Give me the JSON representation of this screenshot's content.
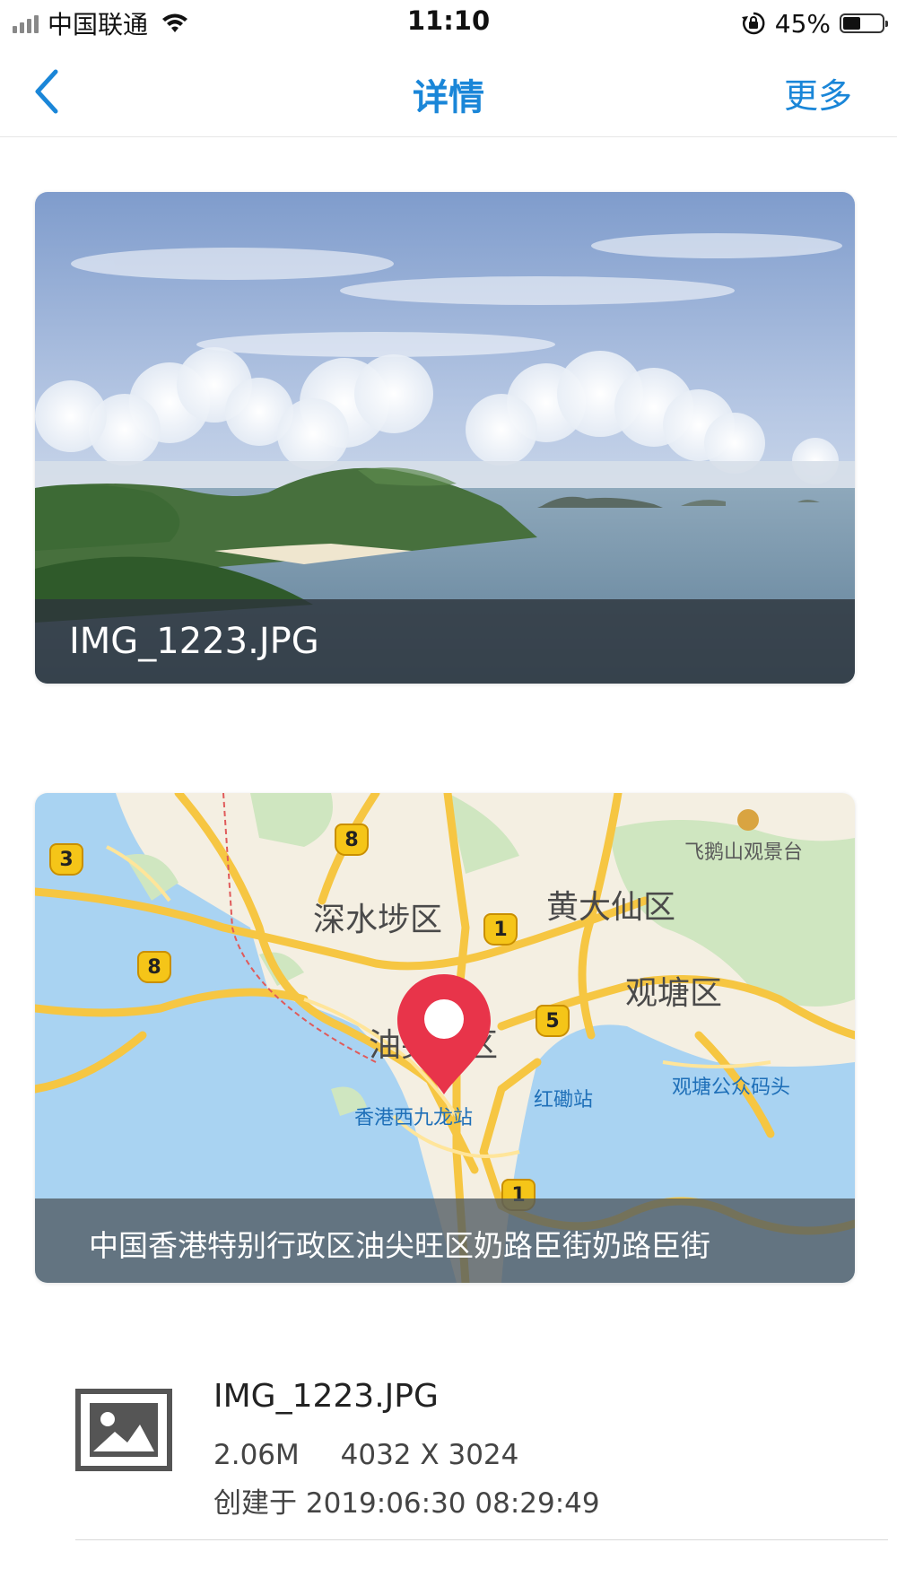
{
  "status_bar": {
    "carrier": "中国联通",
    "time": "11:10",
    "battery": "45%",
    "battery_level": 0.45,
    "icons": [
      "signal-icon",
      "wifi-icon",
      "rotation-lock-icon",
      "battery-icon"
    ]
  },
  "nav": {
    "title": "详情",
    "more": "更多",
    "back_icon": "chevron-left-icon",
    "accent_color": "#1a86d8"
  },
  "photo": {
    "filename": "IMG_1223.JPG"
  },
  "map": {
    "address": "中国香港特别行政区油尖旺区奶路臣街奶路臣街",
    "districts": [
      "深水埗区",
      "黄大仙区",
      "观塘区",
      "油尖旺区"
    ],
    "places": [
      "飞鹅山观景台",
      "香港西九龙站",
      "红磡站",
      "观塘公众码头"
    ],
    "route_badges": [
      "3",
      "8",
      "8",
      "1",
      "5",
      "1"
    ],
    "pin_color": "#e8344a"
  },
  "file": {
    "name": "IMG_1223.JPG",
    "size": "2.06M",
    "dimensions": "4032 X 3024",
    "created": "创建于 2019:06:30 08:29:49",
    "icon": "image-file-icon"
  }
}
